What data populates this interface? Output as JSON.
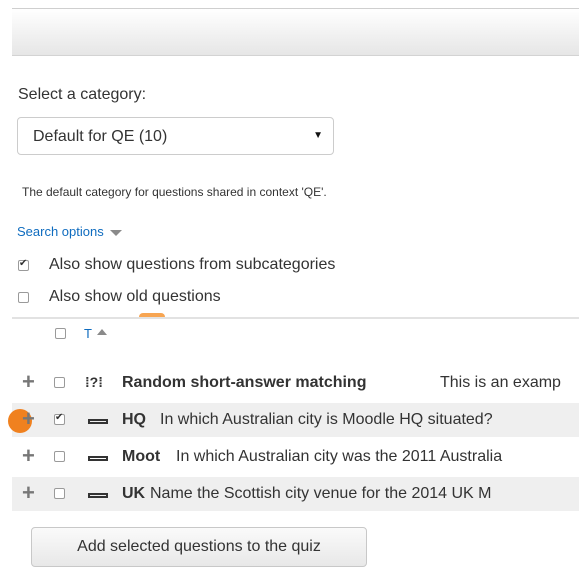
{
  "category": {
    "label": "Select a category:",
    "selected": "Default for QE (10)",
    "description": "The default category for questions shared in context 'QE'."
  },
  "search": {
    "toggle_label": "Search options",
    "options": [
      {
        "label": "Also show questions from subcategories",
        "checked": true
      },
      {
        "label": "Also show old questions",
        "checked": false
      }
    ]
  },
  "table": {
    "type_header": "T",
    "rows": [
      {
        "name": "Random short-answer matching",
        "text": "This is an examp",
        "checked": false,
        "icon": "random-short-answer-icon"
      },
      {
        "name": "HQ",
        "text": "In which Australian city is Moodle HQ situated?",
        "checked": true,
        "icon": "short-answer-icon"
      },
      {
        "name": "Moot",
        "text": "In which Australian city was the 2011 Australia",
        "checked": false,
        "icon": "short-answer-icon"
      },
      {
        "name": "UK",
        "text": "Name  the Scottish city venue for the 2014 UK M",
        "checked": false,
        "icon": "short-answer-icon"
      }
    ]
  },
  "actions": {
    "add_label": "Add selected questions to the quiz"
  },
  "colors": {
    "link": "#0f6cbf",
    "highlight": "#f0811f"
  }
}
